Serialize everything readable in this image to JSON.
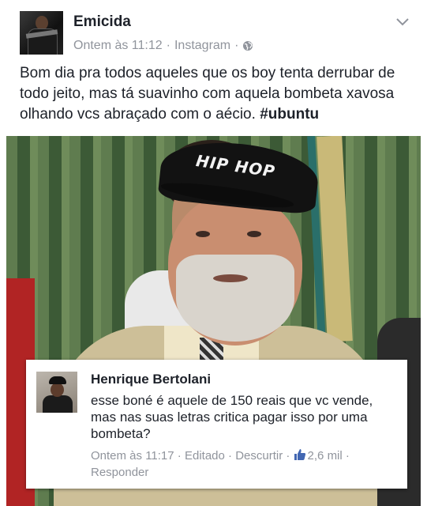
{
  "post": {
    "author": "Emicida",
    "time": "Ontem às 11:12",
    "sep1": "·",
    "source": "Instagram",
    "sep2": "·",
    "privacy_icon": "globe-icon",
    "menu_icon": "chevron-down-icon",
    "text": "Bom dia pra todos aqueles que os boy tenta derrubar de todo jeito, mas tá suavinho com aquela bombeta xavosa olhando vcs abraçado com o aécio.",
    "hashtag": "#ubuntu"
  },
  "photo": {
    "cap_text": "HIP HOP"
  },
  "comment": {
    "author": "Henrique Bertolani",
    "text": "esse boné é aquele de 150 reais que vc vende, mas nas suas letras critica pagar isso por uma bombeta?",
    "time": "Ontem às 11:17",
    "sep": "·",
    "edited": "Editado",
    "unlike": "Descurtir",
    "like_icon": "thumbs-up-icon",
    "likes": "2,6 mil",
    "reply": "Responder"
  },
  "colors": {
    "text": "#1d2129",
    "meta": "#90949c",
    "like_blue": "#4267b2"
  }
}
